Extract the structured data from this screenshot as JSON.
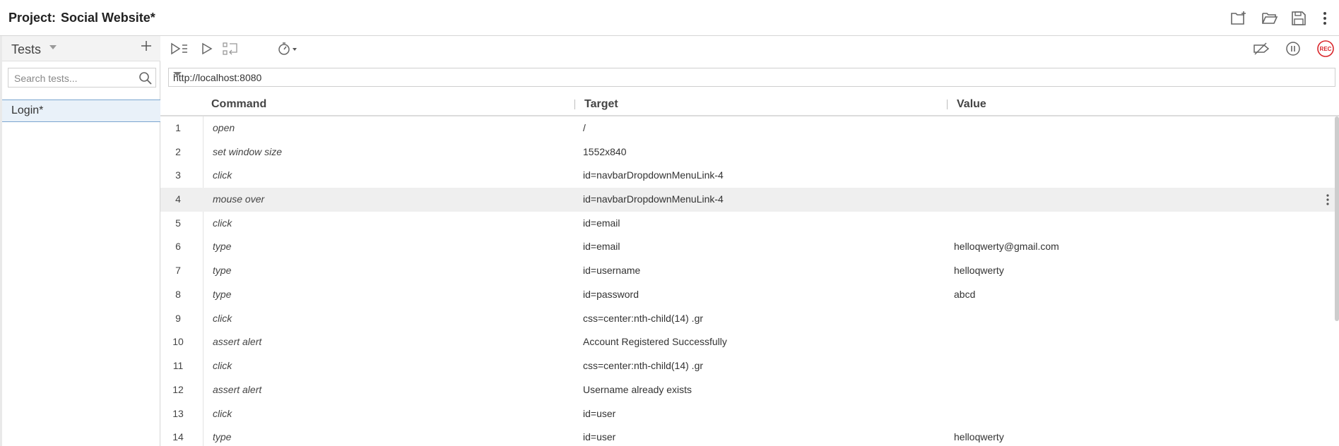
{
  "header": {
    "project_label": "Project:",
    "project_name": "Social Website*",
    "icons": [
      "new-project-icon",
      "open-project-icon",
      "save-project-icon",
      "more-vertical-icon"
    ]
  },
  "sidebar": {
    "title": "Tests",
    "search_placeholder": "Search tests...",
    "tests": [
      {
        "label": "Login*",
        "selected": true
      }
    ]
  },
  "toolbar": {
    "left_icons": [
      "run-all-tests-icon",
      "run-test-icon",
      "step-over-icon",
      "speed-icon"
    ],
    "right_icons": [
      "disable-breakpoints-icon",
      "pause-icon",
      "record-icon"
    ],
    "record_label": "REC"
  },
  "url": {
    "value": "http://localhost:8080"
  },
  "table": {
    "headers": {
      "command": "Command",
      "target": "Target",
      "value": "Value"
    },
    "rows": [
      {
        "num": "1",
        "command": "open",
        "target": "/",
        "value": ""
      },
      {
        "num": "2",
        "command": "set window size",
        "target": "1552x840",
        "value": ""
      },
      {
        "num": "3",
        "command": "click",
        "target": "id=navbarDropdownMenuLink-4",
        "value": ""
      },
      {
        "num": "4",
        "command": "mouse over",
        "target": "id=navbarDropdownMenuLink-4",
        "value": "",
        "highlighted": true
      },
      {
        "num": "5",
        "command": "click",
        "target": "id=email",
        "value": ""
      },
      {
        "num": "6",
        "command": "type",
        "target": "id=email",
        "value": "helloqwerty@gmail.com"
      },
      {
        "num": "7",
        "command": "type",
        "target": "id=username",
        "value": "helloqwerty"
      },
      {
        "num": "8",
        "command": "type",
        "target": "id=password",
        "value": "abcd"
      },
      {
        "num": "9",
        "command": "click",
        "target": "css=center:nth-child(14) .gr",
        "value": ""
      },
      {
        "num": "10",
        "command": "assert alert",
        "target": "Account Registered Successfully",
        "value": ""
      },
      {
        "num": "11",
        "command": "click",
        "target": "css=center:nth-child(14) .gr",
        "value": ""
      },
      {
        "num": "12",
        "command": "assert alert",
        "target": "Username already exists",
        "value": ""
      },
      {
        "num": "13",
        "command": "click",
        "target": "id=user",
        "value": ""
      },
      {
        "num": "14",
        "command": "type",
        "target": "id=user",
        "value": "helloqwerty"
      }
    ]
  },
  "colors": {
    "record": "#d9252a",
    "selected_test_bg": "#e9f1f9",
    "selected_test_border": "#7aa5cf",
    "highlight_row": "#efefef"
  }
}
